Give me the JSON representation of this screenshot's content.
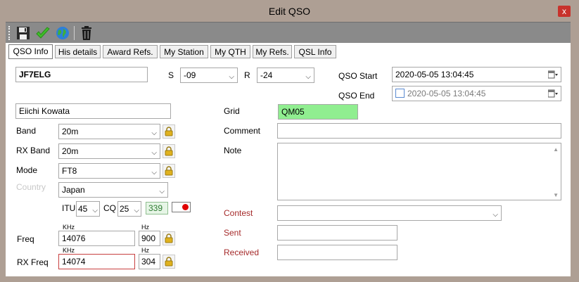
{
  "window": {
    "title": "Edit QSO",
    "close_glyph": "x"
  },
  "toolbar": {
    "icons": [
      "save-icon",
      "check-icon",
      "globe-icon",
      "trash-icon"
    ]
  },
  "tabs": [
    {
      "label": "QSO Info",
      "active": true
    },
    {
      "label": "His details"
    },
    {
      "label": "Award Refs."
    },
    {
      "label": "My Station"
    },
    {
      "label": "My QTH"
    },
    {
      "label": "My Refs."
    },
    {
      "label": "QSL Info"
    }
  ],
  "form": {
    "callsign": "JF7ELG",
    "s_label": "S",
    "s_value": "-09",
    "r_label": "R",
    "r_value": "-24",
    "qso_start_label": "QSO Start",
    "qso_start_value": "2020-05-05 13:04:45",
    "qso_end_label": "QSO End",
    "qso_end_value": "2020-05-05 13:04:45",
    "name": "Eiichi Kowata",
    "grid_label": "Grid",
    "grid_value": "QM05",
    "band_label": "Band",
    "band_value": "20m",
    "comment_label": "Comment",
    "comment_value": "",
    "rxband_label": "RX Band",
    "rxband_value": "20m",
    "note_label": "Note",
    "mode_label": "Mode",
    "mode_value": "FT8",
    "country_label": "Country",
    "country_value": "Japan",
    "itu_label": "ITU",
    "itu_value": "45",
    "cq_label": "CQ",
    "cq_value": "25",
    "dxcc_value": "339",
    "contest_label": "Contest",
    "contest_value": "",
    "sent_label": "Sent",
    "sent_value": "",
    "received_label": "Received",
    "received_value": "",
    "khz_label": "KHz",
    "hz_label": "Hz",
    "freq_label": "Freq",
    "freq_khz": "14076",
    "freq_hz": "900",
    "rxfreq_label": "RX Freq",
    "rxfreq_khz": "14074",
    "rxfreq_hz": "304"
  },
  "colors": {
    "grid_bg": "#90ee90",
    "window_frame": "#ae9f94",
    "close_btn": "#c8322c",
    "flag_red": "#e00000"
  }
}
